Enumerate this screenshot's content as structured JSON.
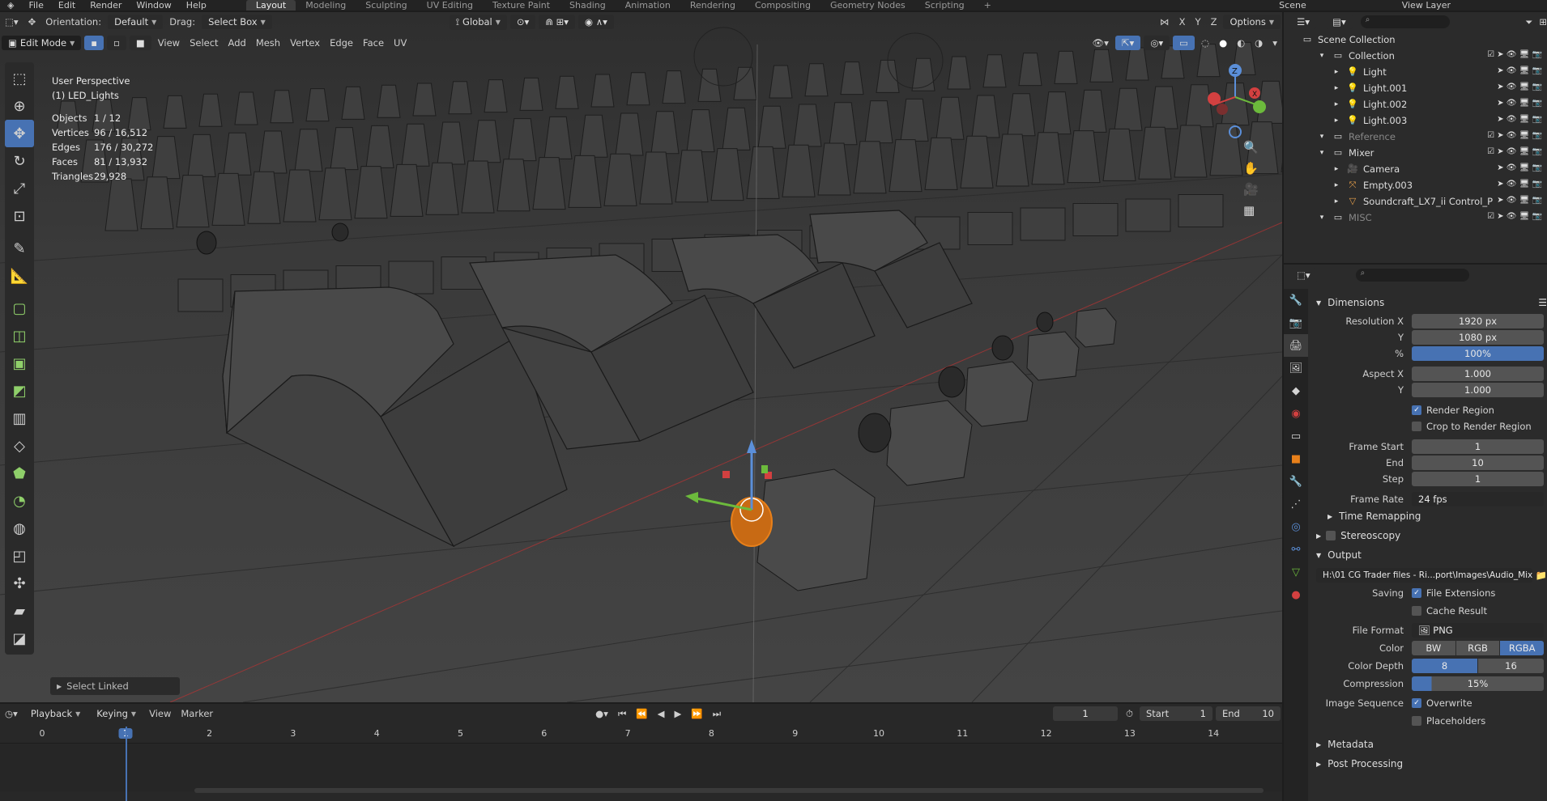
{
  "topbar": {
    "menus": [
      "File",
      "Edit",
      "Render",
      "Window",
      "Help"
    ],
    "workspaces": [
      "Layout",
      "Modeling",
      "Sculpting",
      "UV Editing",
      "Texture Paint",
      "Shading",
      "Animation",
      "Rendering",
      "Compositing",
      "Geometry Nodes",
      "Scripting"
    ],
    "active_workspace": "Layout",
    "scene": "Scene",
    "view_layer": "View Layer"
  },
  "viewport_header1": {
    "orientation_label": "Orientation:",
    "orientation_value": "Default",
    "drag_label": "Drag:",
    "drag_value": "Select Box",
    "transform_orientation": "Global",
    "axes": [
      "X",
      "Y",
      "Z"
    ],
    "options": "Options"
  },
  "viewport_header2": {
    "mode": "Edit Mode",
    "menus": [
      "View",
      "Select",
      "Add",
      "Mesh",
      "Vertex",
      "Edge",
      "Face",
      "UV"
    ]
  },
  "stats": {
    "perspective": "User Perspective",
    "active": "(1) LED_Lights",
    "rows": [
      {
        "k": "Objects",
        "v": "1 / 12"
      },
      {
        "k": "Vertices",
        "v": "96 / 16,512"
      },
      {
        "k": "Edges",
        "v": "176 / 30,272"
      },
      {
        "k": "Faces",
        "v": "81 / 13,932"
      },
      {
        "k": "Triangles",
        "v": "29,928"
      }
    ]
  },
  "last_operator": "Select Linked",
  "outliner": {
    "root": "Scene Collection",
    "items": [
      {
        "name": "Collection",
        "depth": 1,
        "icon": "collection-icon"
      },
      {
        "name": "Light",
        "depth": 2,
        "icon": "light-icon"
      },
      {
        "name": "Light.001",
        "depth": 2,
        "icon": "light-icon"
      },
      {
        "name": "Light.002",
        "depth": 2,
        "icon": "light-icon"
      },
      {
        "name": "Light.003",
        "depth": 2,
        "icon": "light-icon"
      },
      {
        "name": "Reference",
        "depth": 1,
        "icon": "collection-icon"
      },
      {
        "name": "Mixer",
        "depth": 1,
        "icon": "collection-icon"
      },
      {
        "name": "Camera",
        "depth": 2,
        "icon": "camera-icon"
      },
      {
        "name": "Empty.003",
        "depth": 2,
        "icon": "empty-icon"
      },
      {
        "name": "Soundcraft_LX7_ii Control_P",
        "depth": 2,
        "icon": "mesh-icon"
      },
      {
        "name": "MISC",
        "depth": 1,
        "icon": "collection-icon"
      }
    ]
  },
  "properties": {
    "dimensions_title": "Dimensions",
    "resolution_x_label": "Resolution X",
    "resolution_x": "1920 px",
    "resolution_y_label": "Y",
    "resolution_y": "1080 px",
    "percent_label": "%",
    "percent": "100%",
    "aspect_x_label": "Aspect X",
    "aspect_x": "1.000",
    "aspect_y_label": "Y",
    "aspect_y": "1.000",
    "render_region": "Render Region",
    "crop_region": "Crop to Render Region",
    "frame_start_label": "Frame Start",
    "frame_start": "1",
    "frame_end_label": "End",
    "frame_end": "10",
    "frame_step_label": "Step",
    "frame_step": "1",
    "frame_rate_label": "Frame Rate",
    "frame_rate": "24 fps",
    "time_remapping": "Time Remapping",
    "stereoscopy": "Stereoscopy",
    "output_title": "Output",
    "output_path": "H:\\01 CG Trader files - Ri...port\\Images\\Audio_Mixer",
    "saving_label": "Saving",
    "file_extensions": "File Extensions",
    "cache_result": "Cache Result",
    "file_format_label": "File Format",
    "file_format": "PNG",
    "color_label": "Color",
    "color_options": [
      "BW",
      "RGB",
      "RGBA"
    ],
    "color_active": "RGBA",
    "color_depth_label": "Color Depth",
    "color_depth_options": [
      "8",
      "16"
    ],
    "color_depth_active": "8",
    "compression_label": "Compression",
    "compression": "15%",
    "image_sequence_label": "Image Sequence",
    "overwrite": "Overwrite",
    "placeholders": "Placeholders",
    "metadata": "Metadata",
    "post_processing": "Post Processing"
  },
  "timeline": {
    "menus": [
      "Playback",
      "Keying",
      "View",
      "Marker"
    ],
    "current_frame": "1",
    "start_label": "Start",
    "start": "1",
    "end_label": "End",
    "end": "10",
    "ruler": [
      "0",
      "1",
      "2",
      "3",
      "4",
      "5",
      "6",
      "7",
      "8",
      "9",
      "10",
      "11",
      "12",
      "13",
      "14"
    ]
  },
  "colors": {
    "accent": "#4772b3",
    "selected_orange": "#e8801a"
  }
}
